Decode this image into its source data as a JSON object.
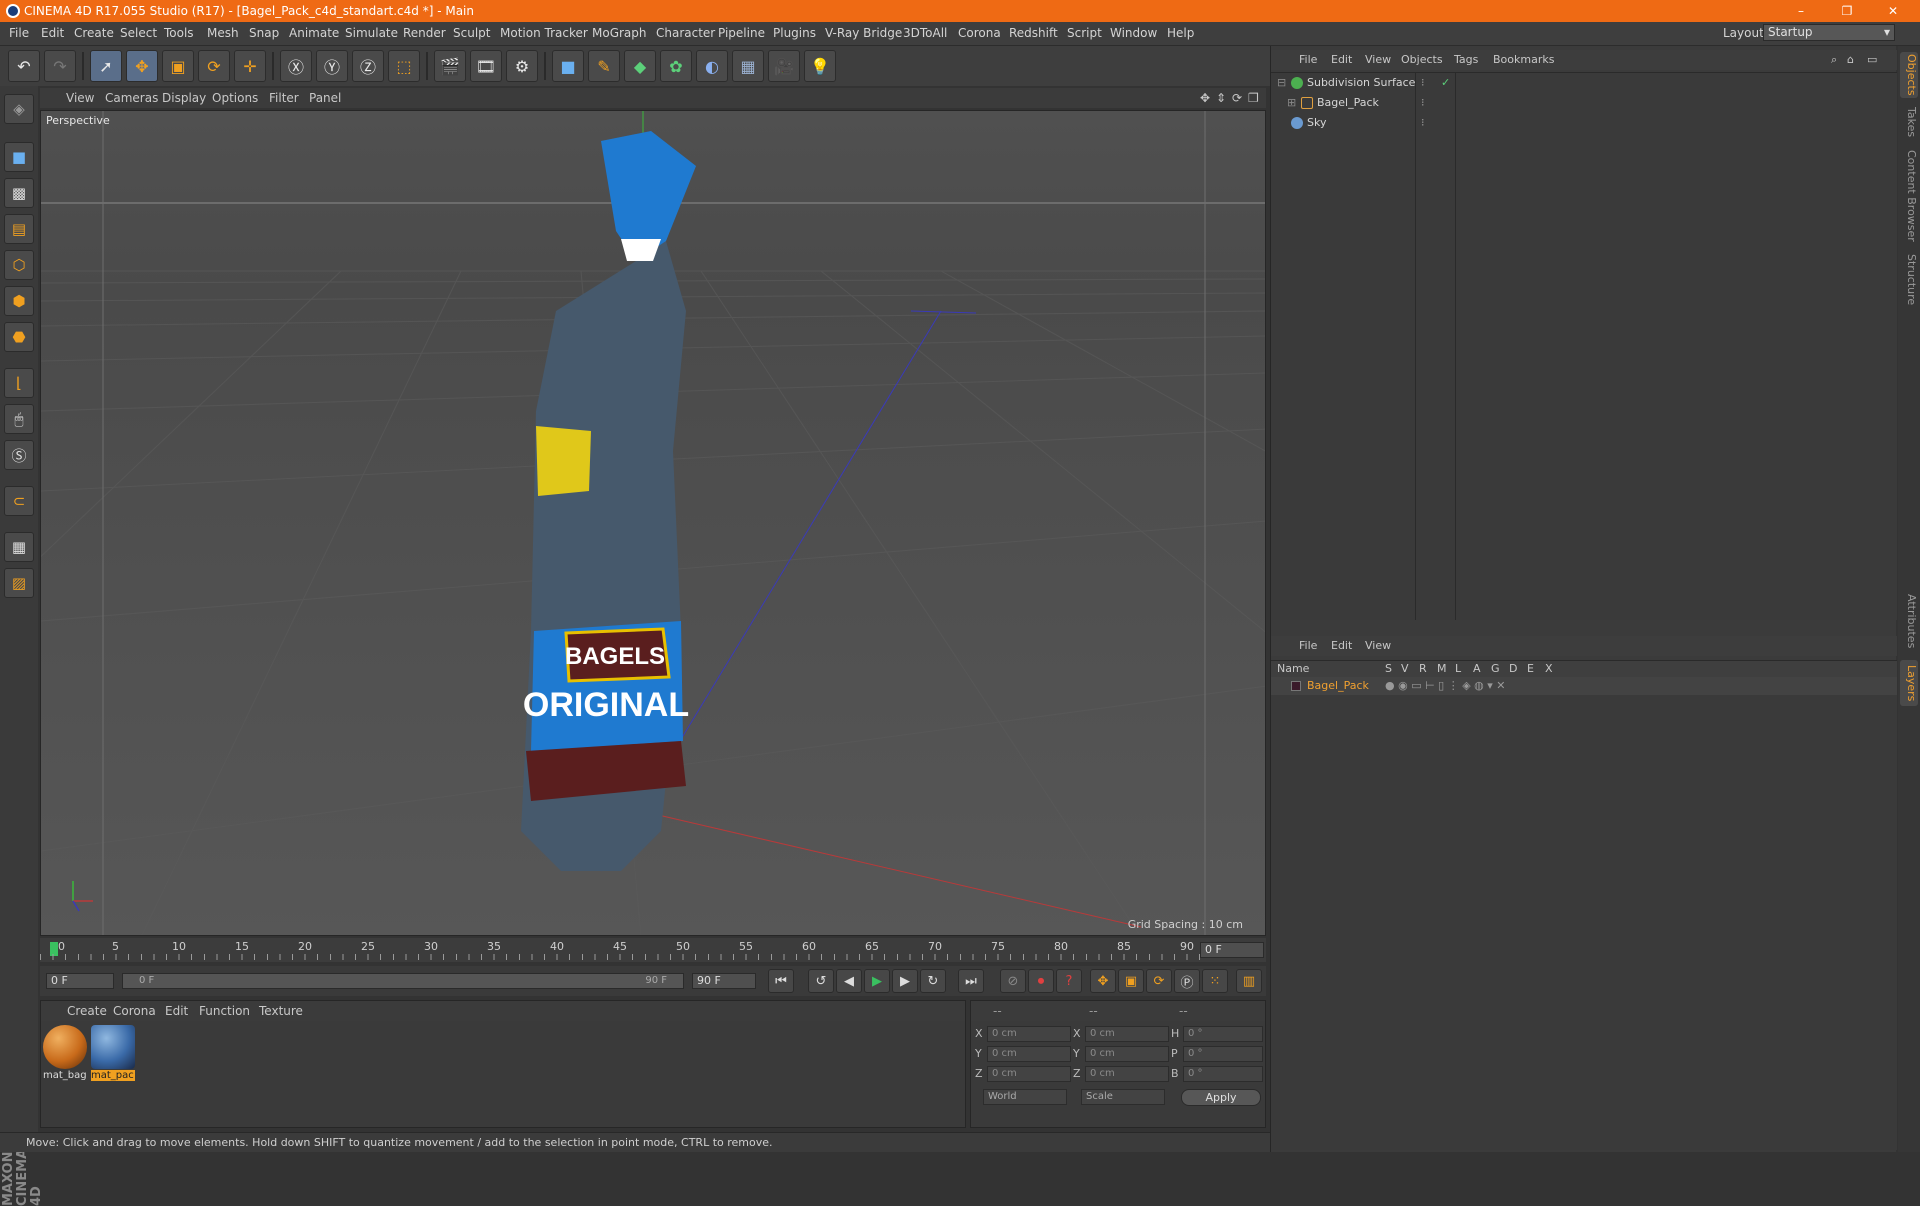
{
  "window": {
    "title": "CINEMA 4D R17.055 Studio (R17) - [Bagel_Pack_c4d_standart.c4d *] - Main",
    "minimize": "–",
    "maximize": "❐",
    "close": "✕"
  },
  "menubar": {
    "items": [
      "File",
      "Edit",
      "Create",
      "Select",
      "Tools",
      "Mesh",
      "Snap",
      "Animate",
      "Simulate",
      "Render",
      "Sculpt",
      "Motion Tracker",
      "MoGraph",
      "Character",
      "Pipeline",
      "Plugins",
      "V-Ray Bridge",
      "3DToAll",
      "Corona",
      "Redshift",
      "Script",
      "Window",
      "Help"
    ],
    "layout_label": "Layout:",
    "layout_value": "Startup"
  },
  "viewport": {
    "menu": [
      "View",
      "Cameras",
      "Display",
      "Options",
      "Filter",
      "Panel"
    ],
    "label": "Perspective",
    "grid_spacing": "Grid Spacing : 10 cm",
    "product_text_1": "BAGELS",
    "product_text_2": "ORIGINAL"
  },
  "timeline": {
    "ticks": [
      "0",
      "5",
      "10",
      "15",
      "20",
      "25",
      "30",
      "35",
      "40",
      "45",
      "50",
      "55",
      "60",
      "65",
      "70",
      "75",
      "80",
      "85",
      "90"
    ],
    "current_frame": "0 F",
    "start_field": "0 F",
    "slider_start": "0 F",
    "slider_end": "90 F",
    "end_field": "90 F"
  },
  "materials": {
    "menu": [
      "Create",
      "Corona",
      "Edit",
      "Function",
      "Texture"
    ],
    "items": [
      {
        "name": "mat_bag",
        "color": "#c86a1a"
      },
      {
        "name": "mat_pac",
        "color": "#3a6aa8"
      }
    ]
  },
  "coordinates": {
    "headers": [
      "--",
      "--",
      "--"
    ],
    "rows": [
      {
        "axis1": "X",
        "val1": "0 cm",
        "axis2": "X",
        "val2": "0 cm",
        "axis3": "H",
        "val3": "0 °"
      },
      {
        "axis1": "Y",
        "val1": "0 cm",
        "axis2": "Y",
        "val2": "0 cm",
        "axis3": "P",
        "val3": "0 °"
      },
      {
        "axis1": "Z",
        "val1": "0 cm",
        "axis2": "Z",
        "val2": "0 cm",
        "axis3": "B",
        "val3": "0 °"
      }
    ],
    "mode": "World",
    "scale": "Scale",
    "apply": "Apply"
  },
  "status": "Move: Click and drag to move elements. Hold down SHIFT to quantize movement / add to the selection in point mode, CTRL to remove.",
  "object_manager": {
    "menu": [
      "File",
      "Edit",
      "View",
      "Objects",
      "Tags",
      "Bookmarks"
    ],
    "objects": [
      {
        "name": "Subdivision Surface",
        "color": "#4caf50"
      },
      {
        "name": "Bagel_Pack",
        "color": "#e0a040"
      },
      {
        "name": "Sky",
        "color": "#6a9ad0"
      }
    ]
  },
  "layer_manager": {
    "menu": [
      "File",
      "Edit",
      "View"
    ],
    "columns": [
      "Name",
      "S",
      "V",
      "R",
      "M",
      "L",
      "A",
      "G",
      "D",
      "E",
      "X"
    ],
    "layer_name": "Bagel_Pack",
    "layer_color": "#f0a030"
  },
  "side_tabs": [
    "Objects",
    "Takes",
    "Content Browser",
    "Structure",
    "Attributes",
    "Layers"
  ],
  "brand": "MAXON CINEMA 4D"
}
